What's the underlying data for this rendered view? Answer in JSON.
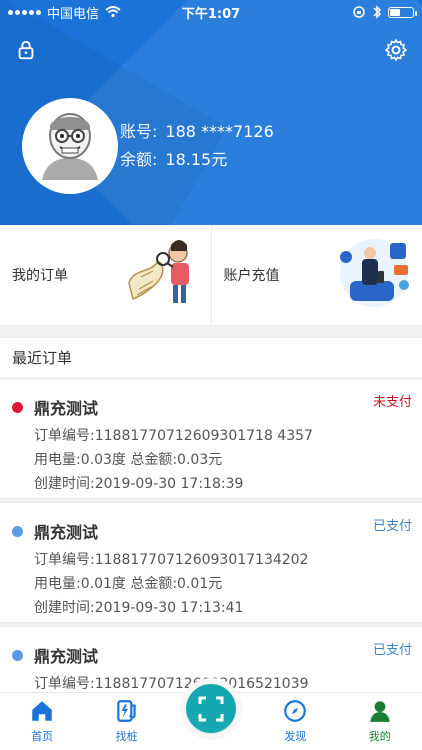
{
  "status_bar": {
    "carrier": "中国电信",
    "time": "下午1:07"
  },
  "profile": {
    "account_label": "账号:",
    "account_value": "188 ****7126",
    "balance_label": "余额:",
    "balance_value": "18.15元"
  },
  "tiles": {
    "orders_label": "我的订单",
    "topup_label": "账户充值"
  },
  "recent_orders": {
    "title": "最近订单",
    "items": [
      {
        "station": "鼎充测试",
        "status": "未支付",
        "status_color": "#c7162b",
        "dot_color": "#e0173a",
        "order_no": "订单编号:11881770712609301718 4357",
        "energy_amount": "用电量:0.03度  总金额:0.03元",
        "created": "创建时间:2019-09-30 17:18:39"
      },
      {
        "station": "鼎充测试",
        "status": "已支付",
        "status_color": "#3f86c8",
        "dot_color": "#5a9ae6",
        "order_no": "订单编号:118817707126093017134202",
        "energy_amount": "用电量:0.01度  总金额:0.01元",
        "created": "创建时间:2019-09-30 17:13:41"
      },
      {
        "station": "鼎充测试",
        "status": "已支付",
        "status_color": "#3f86c8",
        "dot_color": "#5a9ae6",
        "order_no": "订单编号:118817707126093016521039",
        "energy_amount": "",
        "created": ""
      }
    ]
  },
  "bottom_nav": {
    "home": "首页",
    "find_pile": "找桩",
    "discover": "发现",
    "mine": "我的"
  },
  "colors": {
    "header_blue": "#1a73d9",
    "active_green": "#1a7e33",
    "scan_teal": "#15a8b2"
  },
  "icons": {
    "lock": "lock-icon",
    "settings": "gear-icon",
    "home": "home-icon",
    "pile": "charger-icon",
    "scan": "scan-icon",
    "discover": "compass-icon",
    "mine": "user-icon"
  }
}
